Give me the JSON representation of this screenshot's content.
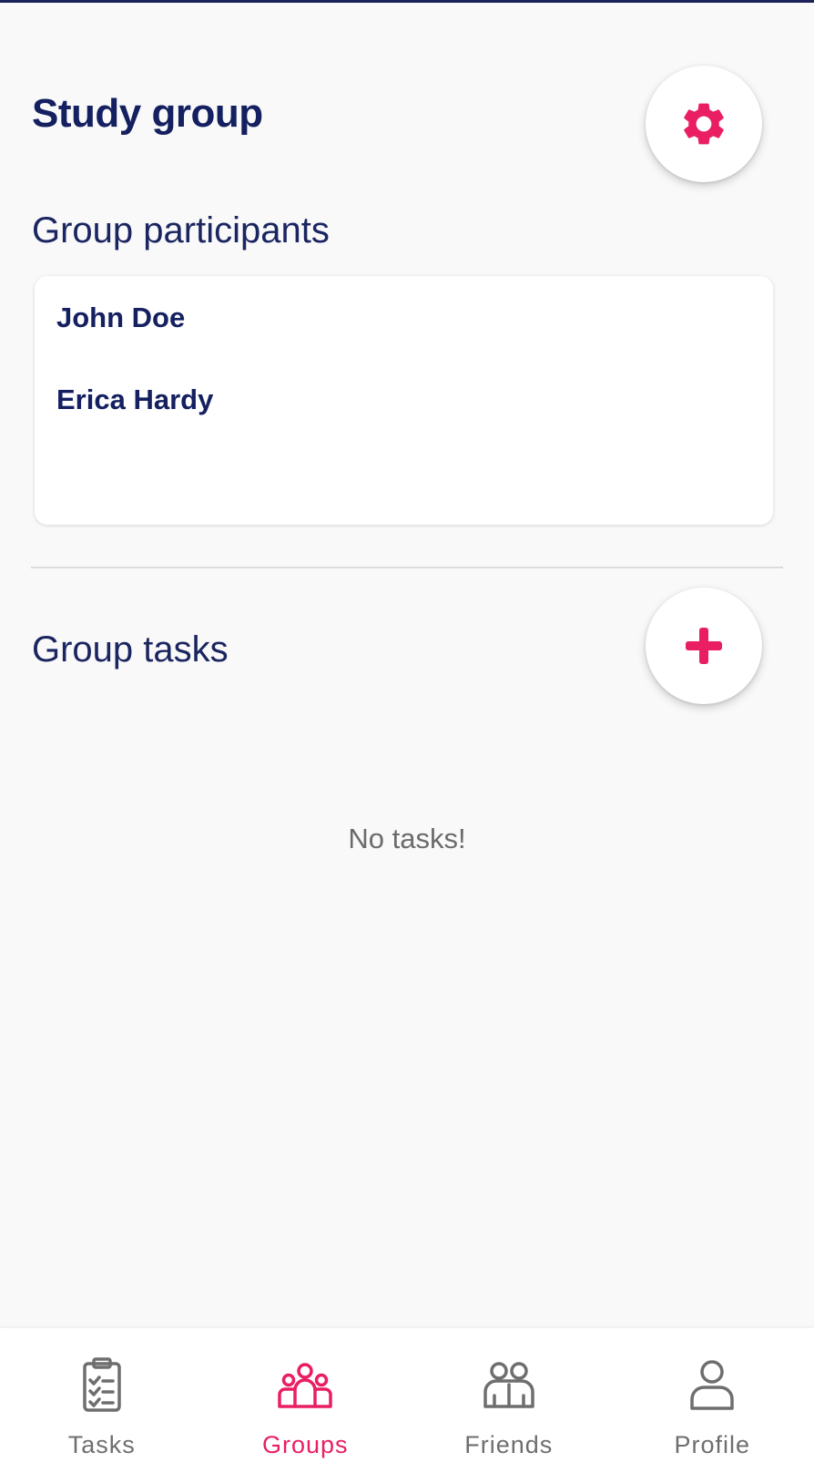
{
  "colors": {
    "accent": "#e91e63",
    "navy": "#142060",
    "inactive": "#6e6e6e",
    "background": "#f9f9fa"
  },
  "header": {
    "title": "Study group",
    "settings_icon": "gear-icon"
  },
  "participants": {
    "title": "Group participants",
    "items": [
      {
        "name": "John Doe"
      },
      {
        "name": "Erica Hardy"
      }
    ]
  },
  "tasks": {
    "title": "Group tasks",
    "add_icon": "plus-icon",
    "empty_text": "No tasks!"
  },
  "bottom_nav": {
    "active": "Groups",
    "items": [
      {
        "label": "Tasks",
        "icon": "clipboard-checklist-icon"
      },
      {
        "label": "Groups",
        "icon": "group-icon"
      },
      {
        "label": "Friends",
        "icon": "friends-icon"
      },
      {
        "label": "Profile",
        "icon": "profile-icon"
      }
    ]
  }
}
